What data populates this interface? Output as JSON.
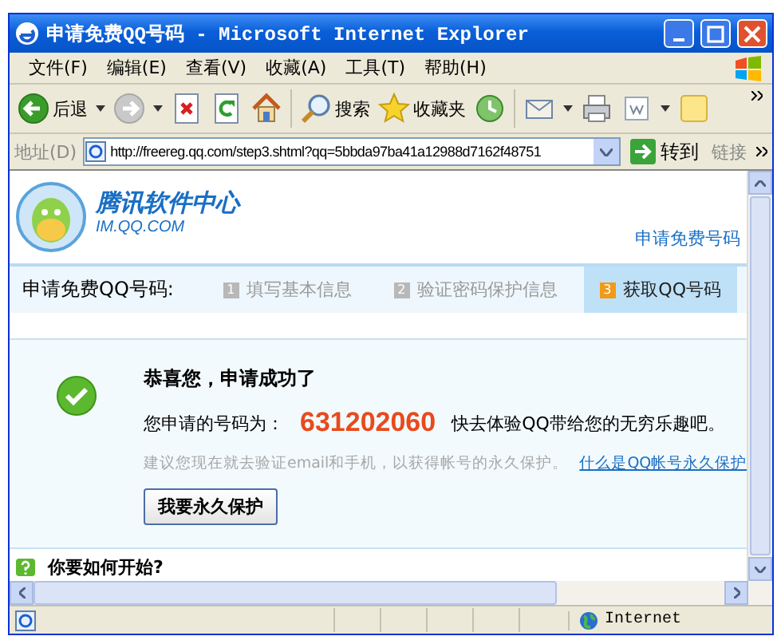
{
  "window": {
    "title": "申请免费QQ号码 - Microsoft Internet Explorer"
  },
  "menu": [
    "文件(F)",
    "编辑(E)",
    "查看(V)",
    "收藏(A)",
    "工具(T)",
    "帮助(H)"
  ],
  "toolbar": [
    {
      "kind": "back",
      "label": "后退",
      "dropdown": true
    },
    {
      "kind": "forward",
      "dropdown": true
    },
    {
      "kind": "stop"
    },
    {
      "kind": "refresh"
    },
    {
      "kind": "home"
    },
    {
      "kind": "search",
      "label": "搜索"
    },
    {
      "kind": "favorites",
      "label": "收藏夹"
    },
    {
      "kind": "history"
    },
    {
      "kind": "mail",
      "dropdown": true
    },
    {
      "kind": "print"
    },
    {
      "kind": "edit",
      "dropdown": true
    },
    {
      "kind": "note"
    }
  ],
  "address": {
    "label": "地址(D)",
    "value": "http://freereg.qq.com/step3.shtml?qq=5bbda97ba41a12988d7162f48751",
    "go": "转到",
    "links": "链接"
  },
  "page": {
    "logo": {
      "title": "腾讯软件中心",
      "subtitle": "IM.QQ.COM"
    },
    "header_link": "申请免费号码",
    "steps_label": "申请免费QQ号码:",
    "steps": [
      {
        "number": "1",
        "label": "填写基本信息",
        "selected": false
      },
      {
        "number": "2",
        "label": "验证密码保护信息",
        "selected": false
      },
      {
        "number": "3",
        "label": "获取QQ号码",
        "selected": true
      }
    ],
    "success": {
      "title": "恭喜您，申请成功了",
      "number_label": "您申请的号码为：",
      "number": "631202060",
      "number_note": "快去体验QQ带给您的无穷乐趣吧。",
      "hint": "建议您现在就去验证email和手机，以获得帐号的永久保护。",
      "hint_link": "什么是QQ帐号永久保护",
      "button": "我要永久保护"
    },
    "next_section": {
      "title": "你要如何开始?"
    }
  },
  "status": {
    "zone": "Internet"
  }
}
